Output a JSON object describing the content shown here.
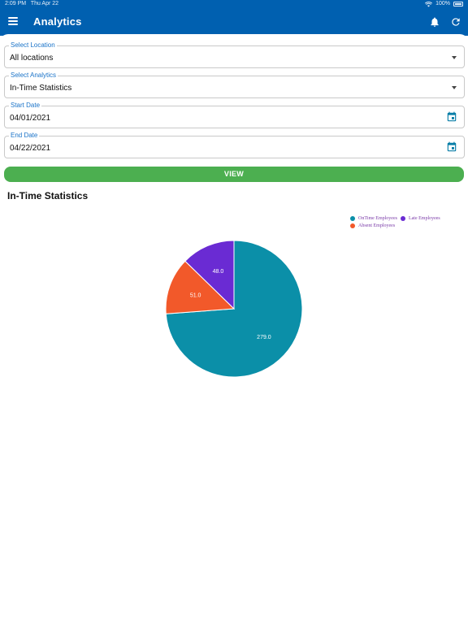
{
  "status_bar": {
    "time": "2:09 PM",
    "date": "Thu Apr 22",
    "battery": "100%"
  },
  "app_bar": {
    "title": "Analytics",
    "icons": [
      "menu-icon",
      "bell-icon",
      "refresh-icon"
    ]
  },
  "filters": {
    "location": {
      "label": "Select Location",
      "value": "All locations"
    },
    "analytics": {
      "label": "Select Analytics",
      "value": "In-Time Statistics"
    },
    "start_date": {
      "label": "Start Date",
      "value": "04/01/2021"
    },
    "end_date": {
      "label": "End Date",
      "value": "04/22/2021"
    }
  },
  "view_button": {
    "label": "VIEW"
  },
  "section_title": "In-Time Statistics",
  "colors": {
    "app_bar": "#0060b0",
    "view_button": "#4caf50",
    "ontime": "#0b8fa8",
    "late": "#6a2bd3",
    "absent": "#f2592a",
    "label_blue": "#1a73c8"
  },
  "chart_data": {
    "type": "pie",
    "series": [
      {
        "name": "OnTime Employees",
        "value": 279.0,
        "label": "279.0",
        "color": "#0b8fa8"
      },
      {
        "name": "Absent Employees",
        "value": 51.0,
        "label": "51.0",
        "color": "#f2592a"
      },
      {
        "name": "Late Employees",
        "value": 48.0,
        "label": "48.0",
        "color": "#6a2bd3"
      }
    ],
    "legend_position": "top-right"
  }
}
